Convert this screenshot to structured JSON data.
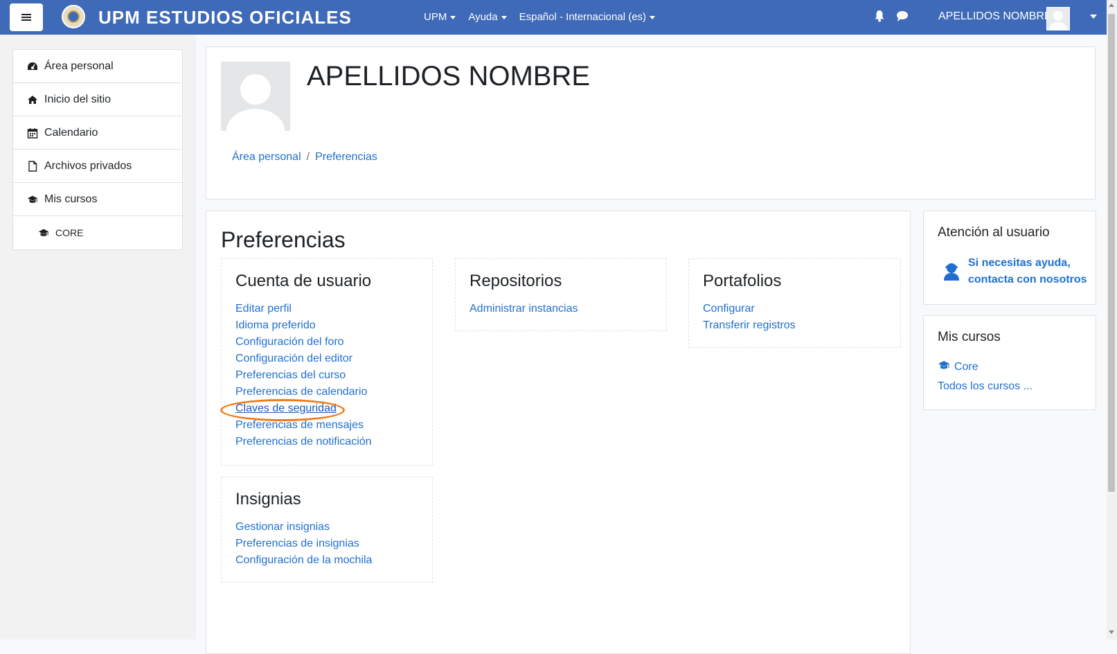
{
  "navbar": {
    "site_name": "UPM ESTUDIOS OFICIALES",
    "menu": [
      "UPM",
      "Ayuda",
      "Español - Internacional (es)"
    ],
    "user_name": "APELLIDOS NOMBRE",
    "bg_color": "#3e6ab8"
  },
  "sidebar": {
    "items": [
      {
        "label": "Área personal",
        "icon": "dashboard-icon"
      },
      {
        "label": "Inicio del sitio",
        "icon": "home-icon"
      },
      {
        "label": "Calendario",
        "icon": "calendar-icon"
      },
      {
        "label": "Archivos privados",
        "icon": "file-icon"
      },
      {
        "label": "Mis cursos",
        "icon": "graduation-cap-icon"
      },
      {
        "label": "CORE",
        "icon": "graduation-cap-icon"
      }
    ]
  },
  "header": {
    "name": "APELLIDOS NOMBRE",
    "breadcrumb": [
      "Área personal",
      "Preferencias"
    ],
    "separator": "/"
  },
  "main": {
    "title": "Preferencias",
    "sections": [
      {
        "title": "Cuenta de usuario",
        "links": [
          "Editar perfil",
          "Idioma preferido",
          "Configuración del foro",
          "Configuración del editor",
          "Preferencias del curso",
          "Preferencias de calendario",
          "Claves de seguridad",
          "Preferencias de mensajes",
          "Preferencias de notificación"
        ]
      },
      {
        "title": "Repositorios",
        "links": [
          "Administrar instancias"
        ]
      },
      {
        "title": "Portafolios",
        "links": [
          "Configurar",
          "Transferir registros"
        ]
      },
      {
        "title": "Insignias",
        "links": [
          "Gestionar insignias",
          "Preferencias de insignias",
          "Configuración de la mochila"
        ]
      }
    ],
    "highlight_color": "#f07a1a"
  },
  "right": {
    "support": {
      "title": "Atención al usuario",
      "link_line1": "Si necesitas ayuda,",
      "link_line2": "contacta con nosotros"
    },
    "courses": {
      "title": "Mis cursos",
      "course": "Core",
      "all": "Todos los cursos ..."
    }
  }
}
